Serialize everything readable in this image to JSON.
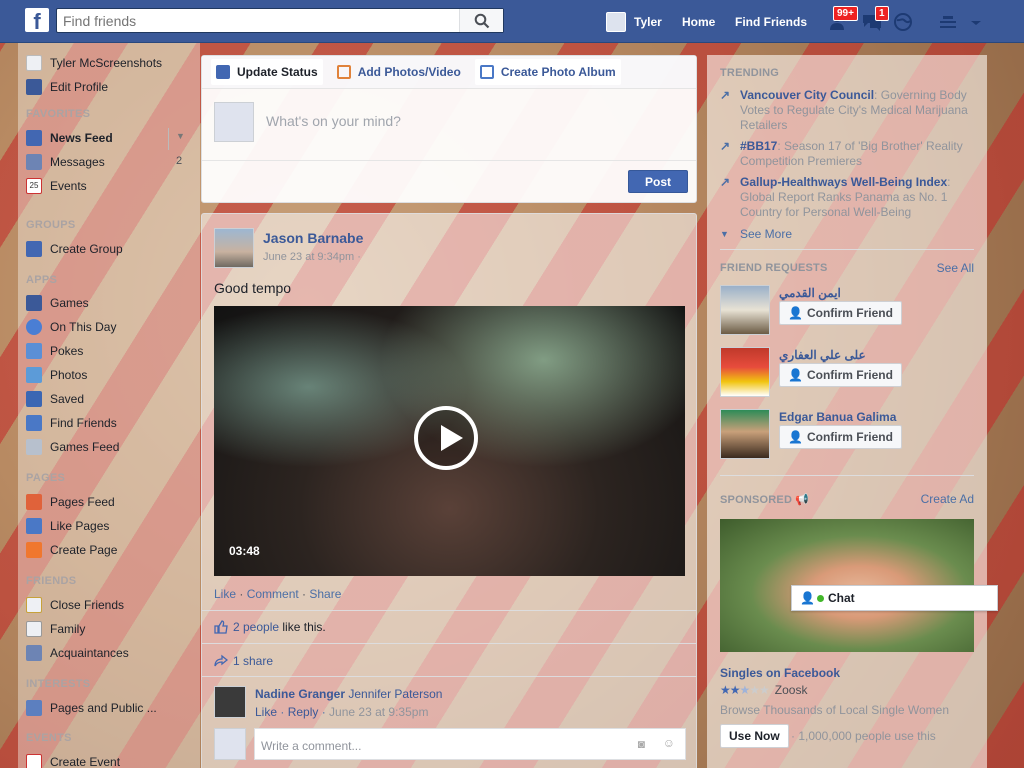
{
  "topbar": {
    "logo": "f",
    "search_placeholder": "Find friends",
    "user_name": "Tyler",
    "home": "Home",
    "find_friends": "Find Friends",
    "friend_requests_badge": "99+",
    "messages_badge": "1"
  },
  "sidebar": {
    "profile_name": "Tyler McScreenshots",
    "edit_profile": "Edit Profile",
    "favorites_header": "FAVORITES",
    "favorites": [
      {
        "label": "News Feed"
      },
      {
        "label": "Messages",
        "count": "2"
      },
      {
        "label": "Events",
        "icon_text": "25"
      }
    ],
    "groups_header": "GROUPS",
    "groups": [
      {
        "label": "Create Group"
      }
    ],
    "apps_header": "APPS",
    "apps": [
      {
        "label": "Games"
      },
      {
        "label": "On This Day"
      },
      {
        "label": "Pokes"
      },
      {
        "label": "Photos"
      },
      {
        "label": "Saved"
      },
      {
        "label": "Find Friends"
      },
      {
        "label": "Games Feed"
      }
    ],
    "pages_header": "PAGES",
    "pages": [
      {
        "label": "Pages Feed"
      },
      {
        "label": "Like Pages"
      },
      {
        "label": "Create Page"
      }
    ],
    "friends_header": "FRIENDS",
    "friends": [
      {
        "label": "Close Friends"
      },
      {
        "label": "Family"
      },
      {
        "label": "Acquaintances"
      }
    ],
    "interests_header": "INTERESTS",
    "interests": [
      {
        "label": "Pages and Public ..."
      }
    ],
    "events_header": "EVENTS",
    "events": [
      {
        "label": "Create Event"
      }
    ]
  },
  "composer": {
    "tab_update": "Update Status",
    "tab_photos": "Add Photos/Video",
    "tab_album": "Create Photo Album",
    "placeholder": "What's on your mind?",
    "post_button": "Post"
  },
  "post": {
    "author": "Jason Barnabe",
    "time": "June 23 at 9:34pm",
    "text": "Good tempo",
    "video_duration": "03:48",
    "action_like": "Like",
    "action_comment": "Comment",
    "action_share": "Share",
    "likes_link": "2 people",
    "likes_suffix": "like this.",
    "shares": "1 share",
    "comment_author": "Nadine Granger",
    "comment_tag": "Jennifer Paterson",
    "comment_like": "Like",
    "comment_reply": "Reply",
    "comment_time": "June 23 at 9:35pm",
    "write_comment": "Write a comment..."
  },
  "trending": {
    "header": "TRENDING",
    "items": [
      {
        "title": "Vancouver City Council",
        "desc": ": Governing Body Votes to Regulate City's Medical Marijuana Retailers"
      },
      {
        "title": "#BB17",
        "desc": ": Season 17 of 'Big Brother' Reality Competition Premieres"
      },
      {
        "title": "Gallup-Healthways Well-Being Index",
        "desc": ": Global Report Ranks Panama as No. 1 Country for Personal Well-Being"
      }
    ],
    "see_more": "See More"
  },
  "friend_requests": {
    "header": "FRIEND REQUESTS",
    "see_all": "See All",
    "confirm_label": "Confirm Friend",
    "items": [
      {
        "name": "ايمن القدمي"
      },
      {
        "name": "على علي العفاري"
      },
      {
        "name": "Edgar Banua Galima"
      }
    ]
  },
  "sponsored": {
    "header": "SPONSORED",
    "create_ad": "Create Ad",
    "title": "Singles on Facebook",
    "advertiser": "Zoosk",
    "rating_stars": 2.5,
    "description": "Browse Thousands of Local Single Women",
    "cta": "Use Now",
    "social": "· 1,000,000 people use this"
  },
  "chat": {
    "label": "Chat"
  },
  "colors": {
    "brand": "#3b5998",
    "link": "#4b6fa6",
    "badge": "#e22222"
  }
}
